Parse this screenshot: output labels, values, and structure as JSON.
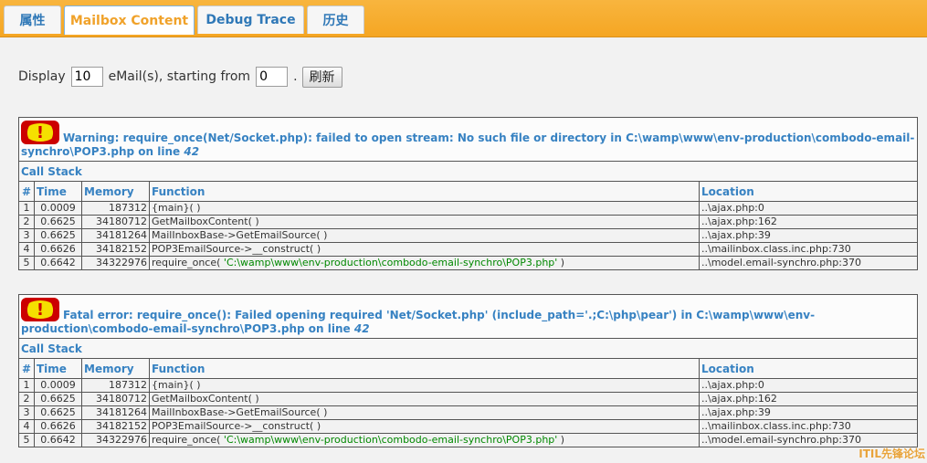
{
  "tabs": [
    {
      "label": "属性",
      "active": false
    },
    {
      "label": "Mailbox Content",
      "active": true
    },
    {
      "label": "Debug Trace",
      "active": false
    },
    {
      "label": "历史",
      "active": false
    }
  ],
  "display": {
    "label_before": "Display",
    "count_value": "10",
    "label_middle": "eMail(s), starting from",
    "start_value": "0",
    "label_after": ".",
    "refresh_label": "刷新"
  },
  "errors": [
    {
      "message": "Warning: require_once(Net/Socket.php): failed to open stream: No such file or directory in C:\\wamp\\www\\env-production\\combodo-email-synchro\\POP3.php on line",
      "line": "42",
      "call_stack_label": "Call Stack",
      "columns": [
        "#",
        "Time",
        "Memory",
        "Function",
        "Location"
      ],
      "rows": [
        {
          "idx": "1",
          "time": "0.0009",
          "memory": "187312",
          "func": "{main}( )",
          "arg": "",
          "func_end": "",
          "location": "..\\ajax.php:0"
        },
        {
          "idx": "2",
          "time": "0.6625",
          "memory": "34180712",
          "func": "GetMailboxContent( )",
          "arg": "",
          "func_end": "",
          "location": "..\\ajax.php:162"
        },
        {
          "idx": "3",
          "time": "0.6625",
          "memory": "34181264",
          "func": "MailInboxBase->GetEmailSource( )",
          "arg": "",
          "func_end": "",
          "location": "..\\ajax.php:39"
        },
        {
          "idx": "4",
          "time": "0.6626",
          "memory": "34182152",
          "func": "POP3EmailSource->__construct( )",
          "arg": "",
          "func_end": "",
          "location": "..\\mailinbox.class.inc.php:730"
        },
        {
          "idx": "5",
          "time": "0.6642",
          "memory": "34322976",
          "func": "require_once( ",
          "arg": "'C:\\wamp\\www\\env-production\\combodo-email-synchro\\POP3.php'",
          "func_end": " )",
          "location": "..\\model.email-synchro.php:370"
        }
      ]
    },
    {
      "message": "Fatal error: require_once(): Failed opening required 'Net/Socket.php' (include_path='.;C:\\php\\pear') in C:\\wamp\\www\\env-production\\combodo-email-synchro\\POP3.php on line",
      "line": "42",
      "call_stack_label": "Call Stack",
      "columns": [
        "#",
        "Time",
        "Memory",
        "Function",
        "Location"
      ],
      "rows": [
        {
          "idx": "1",
          "time": "0.0009",
          "memory": "187312",
          "func": "{main}( )",
          "arg": "",
          "func_end": "",
          "location": "..\\ajax.php:0"
        },
        {
          "idx": "2",
          "time": "0.6625",
          "memory": "34180712",
          "func": "GetMailboxContent( )",
          "arg": "",
          "func_end": "",
          "location": "..\\ajax.php:162"
        },
        {
          "idx": "3",
          "time": "0.6625",
          "memory": "34181264",
          "func": "MailInboxBase->GetEmailSource( )",
          "arg": "",
          "func_end": "",
          "location": "..\\ajax.php:39"
        },
        {
          "idx": "4",
          "time": "0.6626",
          "memory": "34182152",
          "func": "POP3EmailSource->__construct( )",
          "arg": "",
          "func_end": "",
          "location": "..\\mailinbox.class.inc.php:730"
        },
        {
          "idx": "5",
          "time": "0.6642",
          "memory": "34322976",
          "func": "require_once( ",
          "arg": "'C:\\wamp\\www\\env-production\\combodo-email-synchro\\POP3.php'",
          "func_end": " )",
          "location": "..\\model.email-synchro.php:370"
        }
      ]
    }
  ],
  "watermark": "ITIL先锋论坛",
  "colors": {
    "tab_bar": "#f5a623",
    "tab_text": "#2f78b7",
    "active_tab_text": "#f0a22a",
    "error_text": "#3782c2",
    "error_icon": "#cc0000",
    "arg_text": "#008800"
  }
}
